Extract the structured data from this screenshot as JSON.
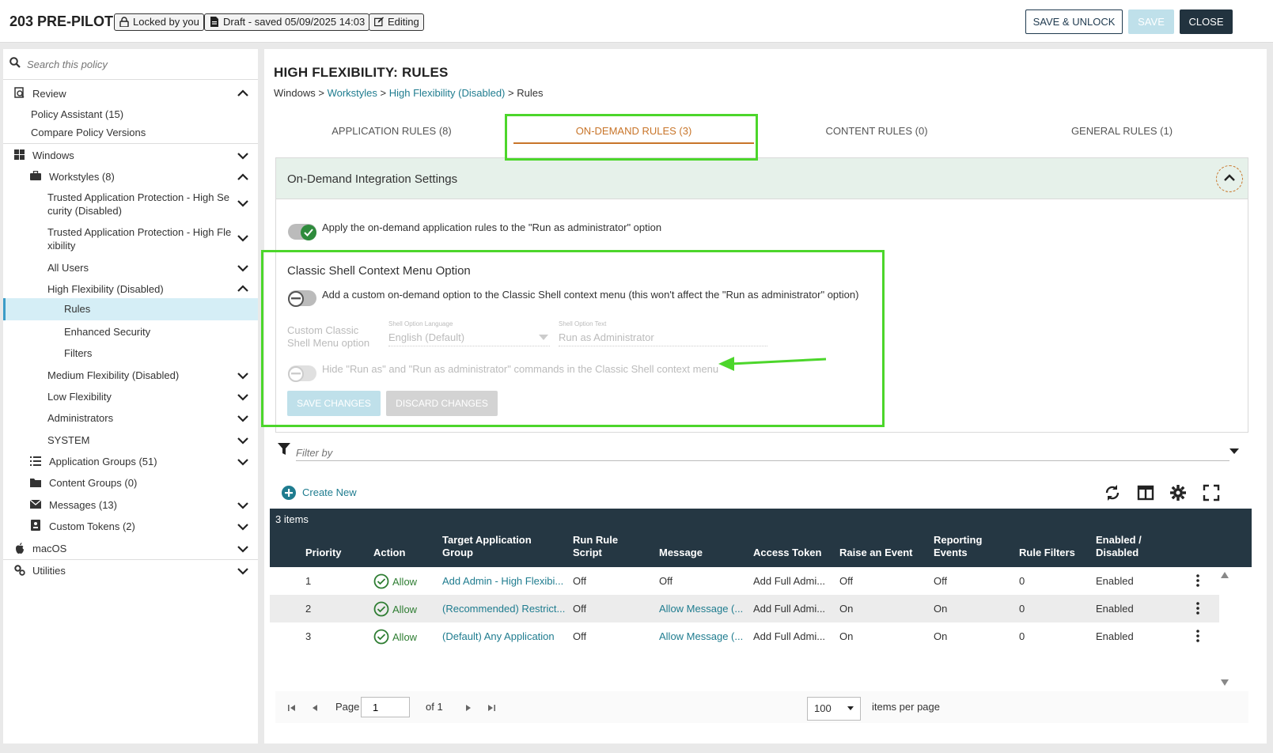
{
  "header": {
    "title": "203 PRE-PILOT",
    "locked": "Locked by you",
    "draft": "Draft - saved 05/09/2025 14:03",
    "editing": "Editing",
    "save_unlock": "SAVE & UNLOCK",
    "save": "SAVE",
    "close": "CLOSE"
  },
  "sidebar": {
    "search_placeholder": "Search this policy",
    "items": [
      {
        "label": "Review"
      },
      {
        "label": "Policy Assistant (15)"
      },
      {
        "label": "Compare Policy Versions"
      },
      {
        "label": "Windows"
      },
      {
        "label": "Workstyles (8)"
      },
      {
        "label": "Trusted Application Protection - High Se",
        "label2": "curity (Disabled)"
      },
      {
        "label": "Trusted Application Protection - High Fle",
        "label2": "xibility"
      },
      {
        "label": "All Users"
      },
      {
        "label": "High Flexibility (Disabled)"
      },
      {
        "label": "Rules"
      },
      {
        "label": "Enhanced Security"
      },
      {
        "label": "Filters"
      },
      {
        "label": "Medium Flexibility (Disabled)"
      },
      {
        "label": "Low Flexibility"
      },
      {
        "label": "Administrators"
      },
      {
        "label": "SYSTEM"
      },
      {
        "label": "Application Groups (51)"
      },
      {
        "label": "Content Groups (0)"
      },
      {
        "label": "Messages (13)"
      },
      {
        "label": "Custom Tokens (2)"
      },
      {
        "label": "macOS"
      },
      {
        "label": "Utilities"
      }
    ]
  },
  "main": {
    "title": "HIGH FLEXIBILITY: RULES",
    "breadcrumb": {
      "root": "Windows",
      "sep": " > ",
      "workstyles": "Workstyles",
      "high_flex": "High Flexibility (Disabled)",
      "current": "Rules"
    },
    "tabs": [
      {
        "label": "APPLICATION RULES (8)"
      },
      {
        "label": "ON-DEMAND RULES (3)"
      },
      {
        "label": "CONTENT RULES (0)"
      },
      {
        "label": "GENERAL RULES (1)"
      }
    ],
    "panel": {
      "title": "On-Demand Integration Settings",
      "apply_text": "Apply the on-demand application rules to the \"Run as administrator\" option",
      "classic_title": "Classic Shell Context Menu Option",
      "classic_text": "Add a custom on-demand option to the Classic Shell context menu (this won't affect the \"Run as administrator\" option)",
      "custom_label_1": "Custom Classic",
      "custom_label_2": "Shell Menu option",
      "lang_label": "Shell Option Language",
      "lang_value": "English (Default)",
      "text_label": "Shell Option Text",
      "text_value": "Run as Administrator",
      "hide_text": "Hide \"Run as\" and \"Run as administrator\" commands in the Classic Shell context menu",
      "save_changes": "SAVE CHANGES",
      "discard_changes": "DISCARD CHANGES"
    },
    "filter_placeholder": "Filter by",
    "create_new": "Create New",
    "grid": {
      "count": "3 items",
      "columns": {
        "priority": "Priority",
        "action": "Action",
        "target_1": "Target Application",
        "target_2": "Group",
        "run_1": "Run Rule",
        "run_2": "Script",
        "message": "Message",
        "token": "Access Token",
        "raise": "Raise an Event",
        "report_1": "Reporting",
        "report_2": "Events",
        "filters": "Rule Filters",
        "enabled_1": "Enabled /",
        "enabled_2": "Disabled"
      },
      "rows": [
        {
          "priority": "1",
          "action": "Allow",
          "target": "Add Admin - High Flexibi...",
          "run": "Off",
          "message": "Off",
          "token": "Add Full Admi...",
          "raise": "Off",
          "report": "Off",
          "filters": "0",
          "enabled": "Enabled"
        },
        {
          "priority": "2",
          "action": "Allow",
          "target": "(Recommended) Restrict...",
          "run": "Off",
          "message": "Allow Message (...",
          "token": "Add Full Admi...",
          "raise": "On",
          "report": "On",
          "filters": "0",
          "enabled": "Enabled"
        },
        {
          "priority": "3",
          "action": "Allow",
          "target": "(Default) Any Application",
          "run": "Off",
          "message": "Allow Message (...",
          "token": "Add Full Admi...",
          "raise": "On",
          "report": "On",
          "filters": "0",
          "enabled": "Enabled"
        }
      ]
    },
    "pager": {
      "page_label": "Page",
      "page_value": "1",
      "of": "of 1",
      "per_page": "100",
      "per_page_label": "items per page"
    }
  },
  "colors": {
    "accent_teal": "#1f7c8f",
    "tab_active": "#c8752a",
    "highlight": "#4cd62b",
    "grid_header": "#253743",
    "allow_green": "#2e7d32"
  }
}
